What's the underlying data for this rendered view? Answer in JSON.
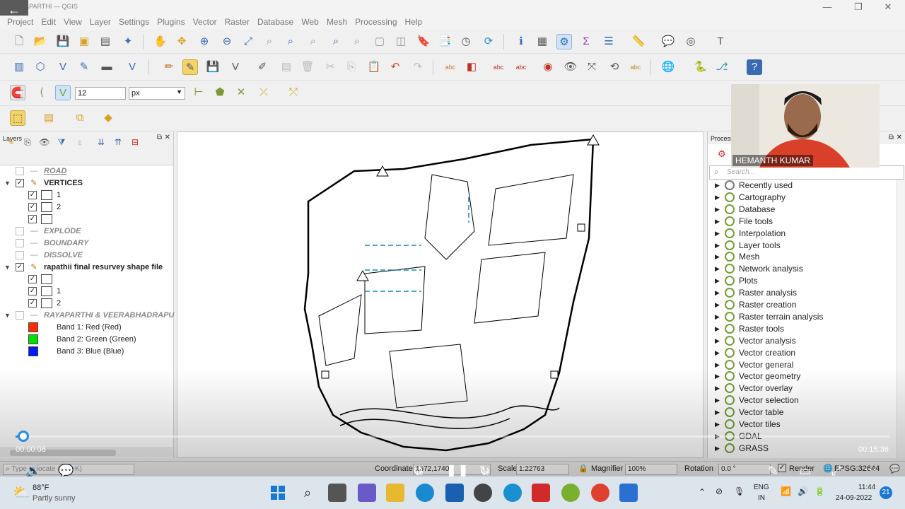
{
  "window": {
    "title": "RAYAPARTHI — QGIS"
  },
  "menu": [
    "Project",
    "Edit",
    "View",
    "Layer",
    "Settings",
    "Plugins",
    "Vector",
    "Raster",
    "Database",
    "Web",
    "Mesh",
    "Processing",
    "Help"
  ],
  "digitizing": {
    "snap_tolerance": "12",
    "snap_units": "px"
  },
  "layers_panel": {
    "title": "Layers",
    "items": [
      {
        "label": "ROAD",
        "style": "ital-underline",
        "checked": false,
        "indent": 0
      },
      {
        "label": "VERTICES",
        "style": "bold",
        "checked": true,
        "indent": 0,
        "expanded": true
      },
      {
        "label": "1",
        "style": "",
        "checked": true,
        "indent": 1
      },
      {
        "label": "2",
        "style": "",
        "checked": true,
        "indent": 1
      },
      {
        "label": "",
        "style": "",
        "checked": true,
        "indent": 1
      },
      {
        "label": "EXPLODE",
        "style": "ital",
        "checked": false,
        "indent": 0
      },
      {
        "label": "BOUNDARY",
        "style": "ital",
        "checked": false,
        "indent": 0
      },
      {
        "label": "DISSOLVE",
        "style": "ital",
        "checked": false,
        "indent": 0
      },
      {
        "label": "rapathii final resurvey shape file",
        "style": "bold",
        "checked": true,
        "indent": 0,
        "expanded": true
      },
      {
        "label": "",
        "style": "",
        "checked": true,
        "indent": 1
      },
      {
        "label": "1",
        "style": "",
        "checked": true,
        "indent": 1
      },
      {
        "label": "2",
        "style": "",
        "checked": true,
        "indent": 1
      },
      {
        "label": "RAYAPARTHI & VEERABHADRAPU",
        "style": "ital",
        "checked": false,
        "indent": 0,
        "expanded": true
      },
      {
        "label": "Band 1: Red (Red)",
        "style": "",
        "indent": 1,
        "swatch": "#ff2a00"
      },
      {
        "label": "Band 2: Green (Green)",
        "style": "",
        "indent": 1,
        "swatch": "#00e000"
      },
      {
        "label": "Band 3: Blue (Blue)",
        "style": "",
        "indent": 1,
        "swatch": "#0018ff"
      }
    ]
  },
  "processing_panel": {
    "title": "Processi",
    "search_placeholder": "Search...",
    "groups": [
      "Recently used",
      "Cartography",
      "Database",
      "File tools",
      "Interpolation",
      "Layer tools",
      "Mesh",
      "Network analysis",
      "Plots",
      "Raster analysis",
      "Raster creation",
      "Raster terrain analysis",
      "Raster tools",
      "Vector analysis",
      "Vector creation",
      "Vector general",
      "Vector geometry",
      "Vector overlay",
      "Vector selection",
      "Vector table",
      "Vector tiles",
      "GDAL",
      "GRASS"
    ]
  },
  "webcam": {
    "name": "HEMANTH KUMAR"
  },
  "statusbar": {
    "locate_placeholder": "Type to locate (Ctrl+K)",
    "coordinate_label": "Coordinate",
    "coordinate_value": "1572,1740",
    "scale_label": "Scale",
    "scale_value": "1:22763",
    "magnifier_label": "Magnifier",
    "magnifier_value": "100%",
    "rotation_label": "Rotation",
    "rotation_value": "0.0 °",
    "render_label": "Render",
    "crs": "EPSG:32644"
  },
  "video": {
    "elapsed": "00:00:08",
    "total": "00:15:36",
    "skip_back": "10",
    "skip_fwd": "30",
    "progress": 0.009
  },
  "taskbar": {
    "weather_temp": "88°F",
    "weather_desc": "Partly sunny",
    "lang1": "ENG",
    "lang2": "IN",
    "time": "11:44",
    "date": "24-09-2022",
    "badge": "21"
  }
}
